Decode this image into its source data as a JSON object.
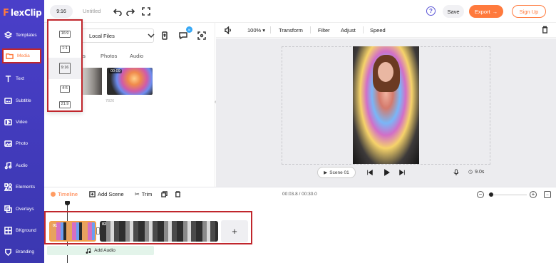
{
  "app": {
    "logo_mark": "F",
    "logo_text": "lexClip",
    "doc_title": "Untitled"
  },
  "sidebar": {
    "items": [
      {
        "label": "Templates",
        "icon": "layers-icon"
      },
      {
        "label": "Media",
        "icon": "folder-icon",
        "active": true
      },
      {
        "label": "Text",
        "icon": "text-icon"
      },
      {
        "label": "Subtitle",
        "icon": "subtitle-icon"
      },
      {
        "label": "Video",
        "icon": "video-icon"
      },
      {
        "label": "Photo",
        "icon": "image-icon"
      },
      {
        "label": "Audio",
        "icon": "music-icon"
      },
      {
        "label": "Elements",
        "icon": "elements-icon"
      },
      {
        "label": "Overlays",
        "icon": "overlay-icon"
      },
      {
        "label": "BKground",
        "icon": "background-icon"
      },
      {
        "label": "Branding",
        "icon": "brand-icon"
      }
    ]
  },
  "topbar": {
    "ratio": "9:16",
    "save": "Save",
    "export": "Export",
    "export_arrow": "→",
    "signup": "Sign Up",
    "help": "?"
  },
  "ratio_menu": {
    "options": [
      "16:9",
      "1:1",
      "9:16",
      "4:5",
      "21:9"
    ],
    "selected": "9:16"
  },
  "media_panel": {
    "source": "Local Files",
    "tabs": [
      "os",
      "Photos",
      "Audio"
    ],
    "clip_duration": "00:09",
    "clip_caption": "7826",
    "ai_badge": "AI"
  },
  "preview": {
    "toolbar": {
      "zoom": "100%",
      "transform": "Transform",
      "filter": "Filter",
      "adjust": "Adjust",
      "speed": "Speed"
    },
    "scene": "Scene 01",
    "duration": "9.0s"
  },
  "timeline": {
    "tab": "Timeline",
    "add_scene": "Add Scene",
    "trim": "Trim",
    "timecode": "00:03.8 / 00:30.0",
    "clips": [
      {
        "num": "01"
      },
      {
        "num": "02"
      }
    ],
    "add_clip": "+",
    "add_audio": "Add Audio"
  },
  "colors": {
    "accent": "#ff7a3d",
    "sidebar": "#3f3ab8",
    "highlight": "#c0262c"
  }
}
